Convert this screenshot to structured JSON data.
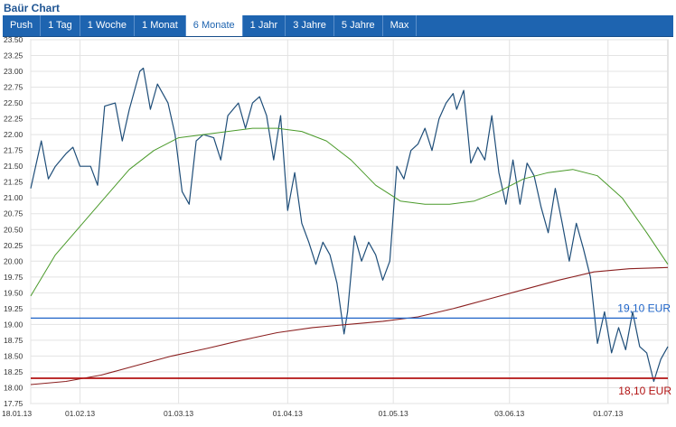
{
  "header": {
    "title": "Baür Chart"
  },
  "tabs": [
    {
      "label": "Push",
      "active": false
    },
    {
      "label": "1 Tag",
      "active": false
    },
    {
      "label": "1 Woche",
      "active": false
    },
    {
      "label": "1 Monat",
      "active": false
    },
    {
      "label": "6 Monate",
      "active": true
    },
    {
      "label": "1 Jahr",
      "active": false
    },
    {
      "label": "3 Jahre",
      "active": false
    },
    {
      "label": "5 Jahre",
      "active": false
    },
    {
      "label": "Max",
      "active": false
    }
  ],
  "colors": {
    "price": "#1f4e79",
    "ma_short": "#4a9a2a",
    "ma_long": "#8b2020",
    "ref_blue": "#1e64c8",
    "ref_red": "#b21212",
    "grid": "#e3e3e3",
    "tab_bg": "#1e64b0"
  },
  "chart_data": {
    "type": "line",
    "title": "",
    "xlabel": "",
    "ylabel": "",
    "ylim": [
      17.75,
      23.5
    ],
    "xlim": [
      "2013-01-18",
      "2013-07-18"
    ],
    "grid": true,
    "yticks": [
      "17.75",
      "18.00",
      "18.25",
      "18.50",
      "18.75",
      "19.00",
      "19.25",
      "19.50",
      "19.75",
      "20.00",
      "20.25",
      "20.50",
      "20.75",
      "21.00",
      "21.25",
      "21.50",
      "21.75",
      "22.00",
      "22.25",
      "22.50",
      "22.75",
      "23.00",
      "23.25",
      "23.50"
    ],
    "xticks": [
      {
        "date": "2013-01-18",
        "label": "18.01.13"
      },
      {
        "date": "2013-02-01",
        "label": "01.02.13"
      },
      {
        "date": "2013-03-01",
        "label": "01.03.13"
      },
      {
        "date": "2013-04-01",
        "label": "01.04.13"
      },
      {
        "date": "2013-05-01",
        "label": "01.05.13"
      },
      {
        "date": "2013-06-03",
        "label": "03.06.13"
      },
      {
        "date": "2013-07-01",
        "label": "01.07.13"
      }
    ],
    "series": [
      {
        "key": "price",
        "points": [
          [
            "2013-01-18",
            21.15
          ],
          [
            "2013-01-21",
            21.9
          ],
          [
            "2013-01-23",
            21.3
          ],
          [
            "2013-01-25",
            21.5
          ],
          [
            "2013-01-28",
            21.7
          ],
          [
            "2013-01-30",
            21.8
          ],
          [
            "2013-02-01",
            21.5
          ],
          [
            "2013-02-04",
            21.5
          ],
          [
            "2013-02-06",
            21.2
          ],
          [
            "2013-02-08",
            22.45
          ],
          [
            "2013-02-11",
            22.5
          ],
          [
            "2013-02-13",
            21.9
          ],
          [
            "2013-02-15",
            22.4
          ],
          [
            "2013-02-18",
            23.0
          ],
          [
            "2013-02-19",
            23.05
          ],
          [
            "2013-02-21",
            22.4
          ],
          [
            "2013-02-23",
            22.8
          ],
          [
            "2013-02-26",
            22.5
          ],
          [
            "2013-02-28",
            22.0
          ],
          [
            "2013-03-02",
            21.1
          ],
          [
            "2013-03-04",
            20.9
          ],
          [
            "2013-03-06",
            21.9
          ],
          [
            "2013-03-08",
            22.0
          ],
          [
            "2013-03-11",
            21.95
          ],
          [
            "2013-03-13",
            21.6
          ],
          [
            "2013-03-15",
            22.3
          ],
          [
            "2013-03-18",
            22.5
          ],
          [
            "2013-03-20",
            22.1
          ],
          [
            "2013-03-22",
            22.5
          ],
          [
            "2013-03-24",
            22.6
          ],
          [
            "2013-03-26",
            22.3
          ],
          [
            "2013-03-28",
            21.6
          ],
          [
            "2013-03-30",
            22.3
          ],
          [
            "2013-04-01",
            20.8
          ],
          [
            "2013-04-03",
            21.4
          ],
          [
            "2013-04-05",
            20.6
          ],
          [
            "2013-04-07",
            20.3
          ],
          [
            "2013-04-09",
            19.95
          ],
          [
            "2013-04-11",
            20.3
          ],
          [
            "2013-04-13",
            20.1
          ],
          [
            "2013-04-15",
            19.65
          ],
          [
            "2013-04-17",
            18.85
          ],
          [
            "2013-04-18",
            19.2
          ],
          [
            "2013-04-20",
            20.4
          ],
          [
            "2013-04-22",
            20.0
          ],
          [
            "2013-04-24",
            20.3
          ],
          [
            "2013-04-26",
            20.1
          ],
          [
            "2013-04-28",
            19.7
          ],
          [
            "2013-04-30",
            20.0
          ],
          [
            "2013-05-02",
            21.5
          ],
          [
            "2013-05-04",
            21.3
          ],
          [
            "2013-05-06",
            21.75
          ],
          [
            "2013-05-08",
            21.85
          ],
          [
            "2013-05-10",
            22.1
          ],
          [
            "2013-05-12",
            21.75
          ],
          [
            "2013-05-14",
            22.25
          ],
          [
            "2013-05-16",
            22.5
          ],
          [
            "2013-05-18",
            22.65
          ],
          [
            "2013-05-19",
            22.4
          ],
          [
            "2013-05-21",
            22.7
          ],
          [
            "2013-05-23",
            21.55
          ],
          [
            "2013-05-25",
            21.8
          ],
          [
            "2013-05-27",
            21.6
          ],
          [
            "2013-05-29",
            22.3
          ],
          [
            "2013-05-31",
            21.4
          ],
          [
            "2013-06-02",
            20.9
          ],
          [
            "2013-06-04",
            21.6
          ],
          [
            "2013-06-06",
            20.9
          ],
          [
            "2013-06-08",
            21.55
          ],
          [
            "2013-06-10",
            21.35
          ],
          [
            "2013-06-12",
            20.85
          ],
          [
            "2013-06-14",
            20.45
          ],
          [
            "2013-06-16",
            21.15
          ],
          [
            "2013-06-18",
            20.6
          ],
          [
            "2013-06-20",
            20.0
          ],
          [
            "2013-06-22",
            20.6
          ],
          [
            "2013-06-24",
            20.2
          ],
          [
            "2013-06-26",
            19.75
          ],
          [
            "2013-06-28",
            18.7
          ],
          [
            "2013-06-30",
            19.2
          ],
          [
            "2013-07-02",
            18.55
          ],
          [
            "2013-07-04",
            18.95
          ],
          [
            "2013-07-06",
            18.6
          ],
          [
            "2013-07-08",
            19.2
          ],
          [
            "2013-07-10",
            18.65
          ],
          [
            "2013-07-12",
            18.55
          ],
          [
            "2013-07-14",
            18.1
          ],
          [
            "2013-07-16",
            18.45
          ],
          [
            "2013-07-18",
            18.65
          ]
        ]
      },
      {
        "key": "ma_short",
        "points": [
          [
            "2013-01-18",
            19.45
          ],
          [
            "2013-01-25",
            20.1
          ],
          [
            "2013-02-01",
            20.55
          ],
          [
            "2013-02-08",
            21.0
          ],
          [
            "2013-02-15",
            21.45
          ],
          [
            "2013-02-22",
            21.75
          ],
          [
            "2013-03-01",
            21.95
          ],
          [
            "2013-03-08",
            22.0
          ],
          [
            "2013-03-15",
            22.05
          ],
          [
            "2013-03-22",
            22.1
          ],
          [
            "2013-03-29",
            22.1
          ],
          [
            "2013-04-05",
            22.05
          ],
          [
            "2013-04-12",
            21.9
          ],
          [
            "2013-04-19",
            21.6
          ],
          [
            "2013-04-26",
            21.2
          ],
          [
            "2013-05-03",
            20.95
          ],
          [
            "2013-05-10",
            20.9
          ],
          [
            "2013-05-17",
            20.9
          ],
          [
            "2013-05-24",
            20.95
          ],
          [
            "2013-05-31",
            21.1
          ],
          [
            "2013-06-07",
            21.3
          ],
          [
            "2013-06-14",
            21.4
          ],
          [
            "2013-06-21",
            21.45
          ],
          [
            "2013-06-28",
            21.35
          ],
          [
            "2013-07-05",
            21.0
          ],
          [
            "2013-07-12",
            20.45
          ],
          [
            "2013-07-18",
            19.95
          ]
        ]
      },
      {
        "key": "ma_long",
        "points": [
          [
            "2013-01-18",
            18.05
          ],
          [
            "2013-01-28",
            18.1
          ],
          [
            "2013-02-07",
            18.2
          ],
          [
            "2013-02-17",
            18.35
          ],
          [
            "2013-02-27",
            18.5
          ],
          [
            "2013-03-09",
            18.62
          ],
          [
            "2013-03-19",
            18.75
          ],
          [
            "2013-03-29",
            18.87
          ],
          [
            "2013-04-08",
            18.95
          ],
          [
            "2013-04-18",
            19.0
          ],
          [
            "2013-04-28",
            19.05
          ],
          [
            "2013-05-08",
            19.12
          ],
          [
            "2013-05-18",
            19.25
          ],
          [
            "2013-05-28",
            19.4
          ],
          [
            "2013-06-07",
            19.55
          ],
          [
            "2013-06-17",
            19.7
          ],
          [
            "2013-06-27",
            19.83
          ],
          [
            "2013-07-07",
            19.88
          ],
          [
            "2013-07-18",
            19.9
          ]
        ]
      }
    ],
    "reference_lines": [
      {
        "key": "ref_blue",
        "value": 19.1,
        "label": "19,10 EUR"
      },
      {
        "key": "ref_red",
        "value": 18.15,
        "label": "18,10 EUR"
      }
    ]
  }
}
